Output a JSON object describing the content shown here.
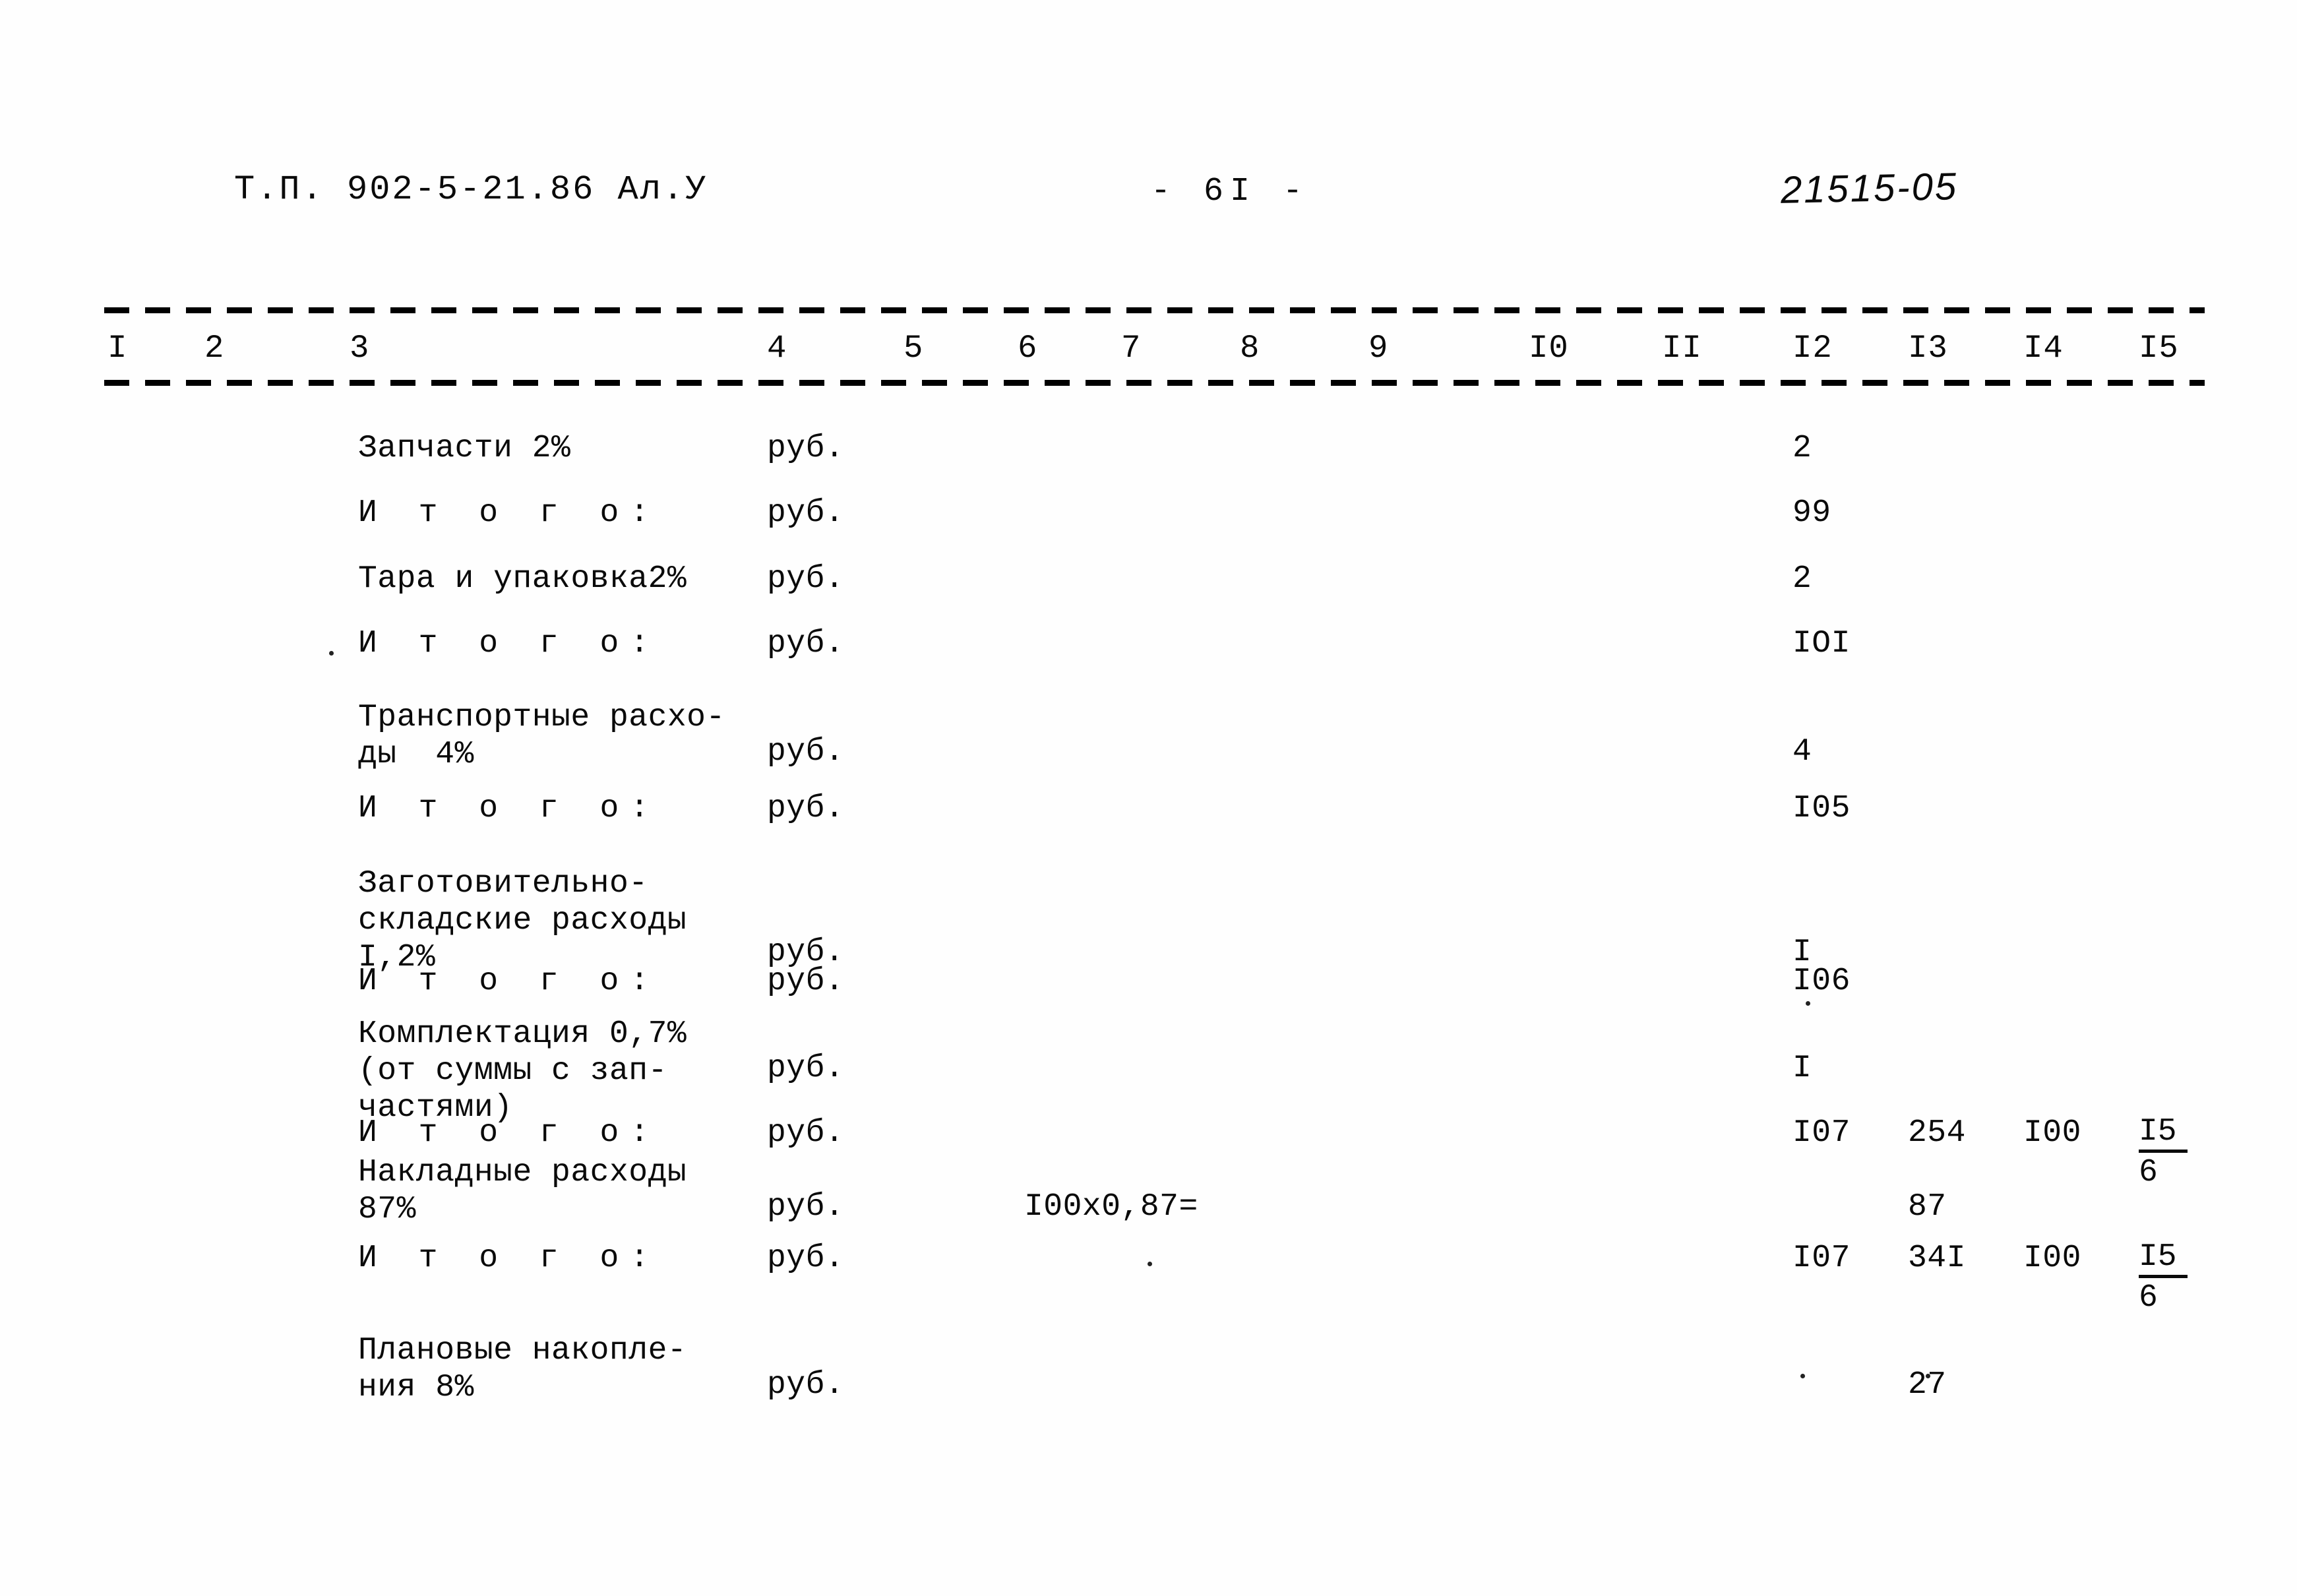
{
  "header": {
    "doc_code": "Т.П. 902-5-21.86  Ал.У",
    "page_number": "- 6I -",
    "archive_code": "21515-05"
  },
  "table": {
    "column_headers": [
      "I",
      "2",
      "3",
      "4",
      "5",
      "6",
      "7",
      "8",
      "9",
      "I0",
      "II",
      "I2",
      "I3",
      "I4",
      "I5"
    ],
    "rows": [
      {
        "description": "Запчасти 2%",
        "unit": "руб.",
        "formula": "",
        "c12": "2",
        "c13": "",
        "c14": "",
        "c15": ""
      },
      {
        "description": "И т о г о:",
        "unit": "руб.",
        "formula": "",
        "c12": "99",
        "c13": "",
        "c14": "",
        "c15": ""
      },
      {
        "description": "Тара и упаковка2%",
        "unit": "руб.",
        "formula": "",
        "c12": "2",
        "c13": "",
        "c14": "",
        "c15": ""
      },
      {
        "description": "И т о г о:",
        "unit": "руб.",
        "formula": "",
        "c12": "IOI",
        "c13": "",
        "c14": "",
        "c15": ""
      },
      {
        "description": "Транспортные расхо-\nды  4%",
        "unit": "руб.",
        "formula": "",
        "c12": "4",
        "c13": "",
        "c14": "",
        "c15": ""
      },
      {
        "description": "И т о г о:",
        "unit": "руб.",
        "formula": "",
        "c12": "I05",
        "c13": "",
        "c14": "",
        "c15": ""
      },
      {
        "description": "Заготовительно-\nскладские расходы\nI,2%",
        "unit": "руб.",
        "formula": "",
        "c12": "I",
        "c13": "",
        "c14": "",
        "c15": ""
      },
      {
        "description": "И т о г о:",
        "unit": "руб.",
        "formula": "",
        "c12": "I06",
        "c13": "",
        "c14": "",
        "c15": ""
      },
      {
        "description": "Комплектация 0,7%\n(от суммы с зап-\nчастями)",
        "unit": "руб.",
        "formula": "",
        "c12": "I",
        "c13": "",
        "c14": "",
        "c15": ""
      },
      {
        "description": "И т о г о:",
        "unit": "руб.",
        "formula": "",
        "c12": "I07",
        "c13": "254",
        "c14": "I00",
        "c15_fraction": {
          "numerator": "I5",
          "denominator": "6"
        }
      },
      {
        "description": "Накладные расходы\n87%",
        "unit": "руб.",
        "formula": "I00х0,87=",
        "c12": "",
        "c13": "87",
        "c14": "",
        "c15": ""
      },
      {
        "description": "И т о г о:",
        "unit": "руб.",
        "formula": "",
        "c12": "I07",
        "c13": "34I",
        "c14": "I00",
        "c15_fraction": {
          "numerator": "I5",
          "denominator": "6"
        }
      },
      {
        "description": "Плановые накопле-\nния 8%",
        "unit": "руб.",
        "formula": "",
        "c12": "",
        "c13": "27",
        "c14": "",
        "c15": ""
      }
    ]
  }
}
